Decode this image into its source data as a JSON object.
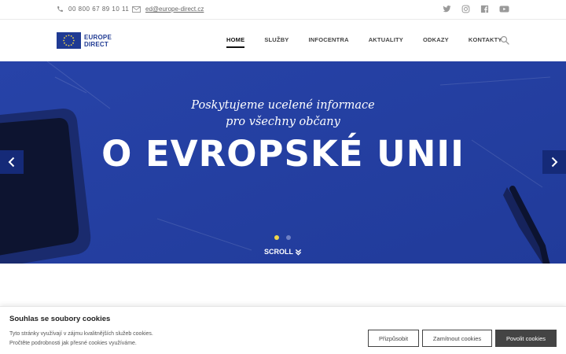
{
  "topbar": {
    "phone": "00 800 67 89 10 11",
    "email": "ed@europe-direct.cz",
    "social_icons": [
      "twitter-icon",
      "instagram-icon",
      "facebook-icon",
      "youtube-icon"
    ]
  },
  "logo": {
    "line1": "EUROPE",
    "line2": "DIRECT"
  },
  "nav": {
    "items": [
      {
        "label": "HOME",
        "active": true
      },
      {
        "label": "SLUŽBY"
      },
      {
        "label": "INFOCENTRA"
      },
      {
        "label": "AKTUALITY"
      },
      {
        "label": "ODKAZY"
      },
      {
        "label": "KONTAKTY"
      }
    ]
  },
  "hero": {
    "subtitle_line1": "Poskytujeme ucelené informace",
    "subtitle_line2": "pro všechny občany",
    "headline": "O EVROPSKÉ UNII",
    "scroll_label": "SCROLL",
    "slide_count": 2,
    "active_slide": 1
  },
  "cookie": {
    "title": "Souhlas se soubory cookies",
    "text_line1": "Tyto stránky využívají v zájmu kvalitnějších služeb cookies.",
    "text_line2": "Pročtěte podrobnosti jak přesné cookies využíváme.",
    "btn_customize": "Přizpůsobit",
    "btn_reject": "Zamítnout cookies",
    "btn_accept": "Povolit cookies"
  },
  "colors": {
    "brand_blue": "#1f3a93",
    "hero_blue": "#2a43a3",
    "dot_active": "#f0d64a",
    "dot_inactive": "#6f80c4",
    "dark_button": "#444444"
  }
}
